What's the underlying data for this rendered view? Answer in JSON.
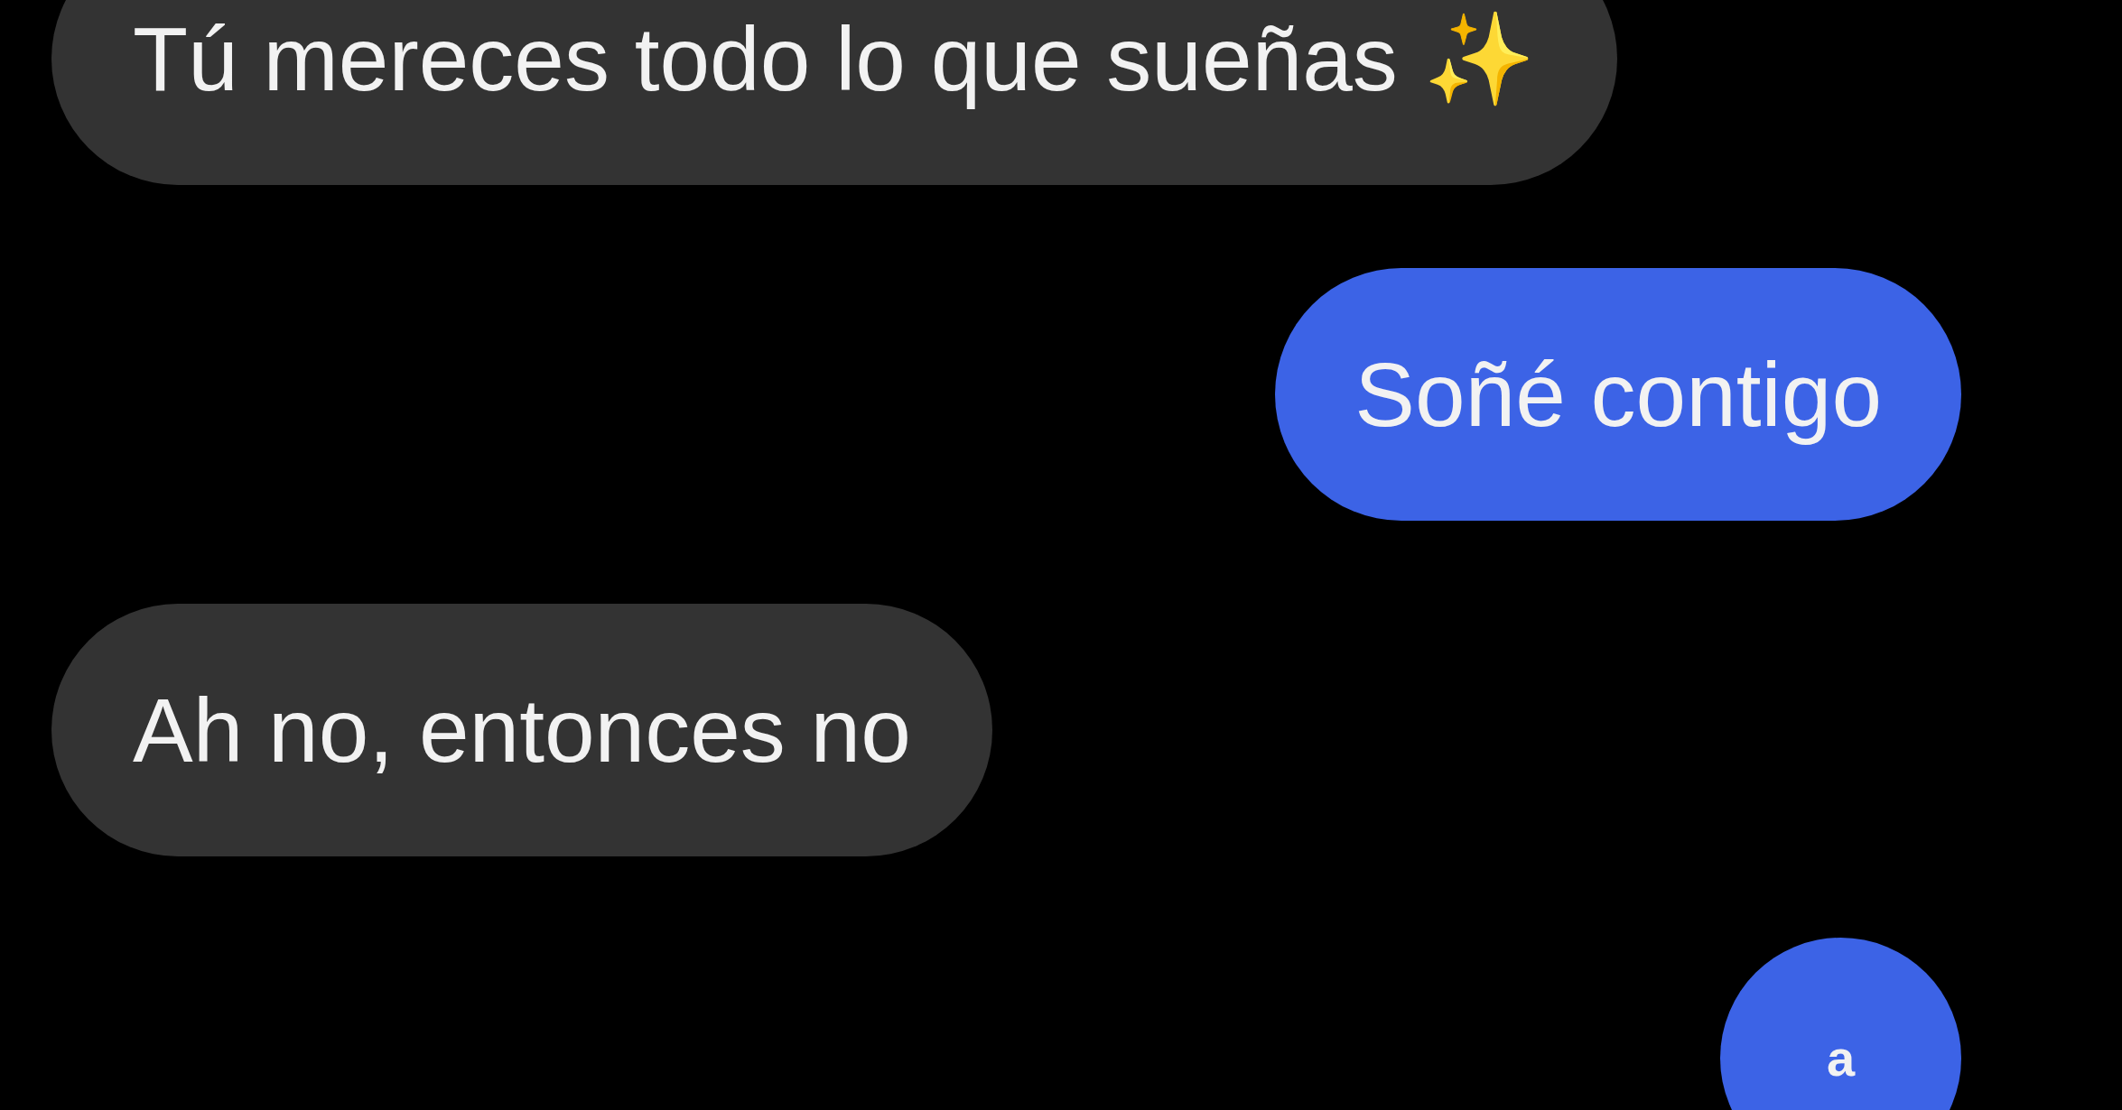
{
  "messages": [
    {
      "kind": "received",
      "text": "Tú mereces todo lo que sueñas ✨"
    },
    {
      "kind": "sent",
      "text": "Soñé contigo"
    },
    {
      "kind": "received",
      "text": "Ah no, entonces no"
    },
    {
      "kind": "sent",
      "text": "a"
    }
  ]
}
